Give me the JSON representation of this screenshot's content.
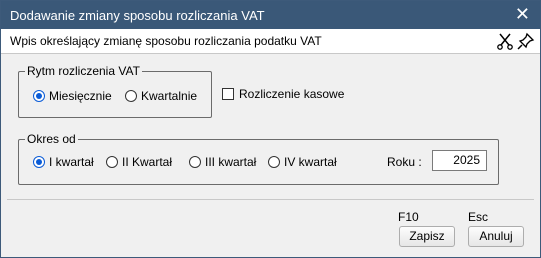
{
  "window": {
    "title": "Dodawanie zmiany sposobu rozliczania VAT",
    "close_icon": "close-icon"
  },
  "header": {
    "subtitle": "Wpis określający zmianę sposobu rozliczania podatku VAT",
    "icons": [
      "scissors-icon",
      "pin-icon"
    ]
  },
  "rytm": {
    "legend": "Rytm rozliczenia VAT",
    "options": [
      {
        "label": "Miesięcznie",
        "checked": true
      },
      {
        "label": "Kwartalnie",
        "checked": false
      }
    ]
  },
  "kasowe": {
    "label": "Rozliczenie kasowe",
    "checked": false
  },
  "okres": {
    "legend": "Okres od",
    "options": [
      {
        "label": "I kwartał",
        "checked": true
      },
      {
        "label": "II Kwartał",
        "checked": false
      },
      {
        "label": "III kwartał",
        "checked": false
      },
      {
        "label": "IV kwartał",
        "checked": false
      }
    ],
    "year_label": "Roku :",
    "year_value": "2025"
  },
  "actions": {
    "save": {
      "key": "F10",
      "label": "Zapisz"
    },
    "cancel": {
      "key": "Esc",
      "label": "Anuluj"
    }
  },
  "colors": {
    "titlebar": "#3a5878",
    "radio_accent": "#0b5cd7",
    "panel": "#f0f0f0"
  }
}
